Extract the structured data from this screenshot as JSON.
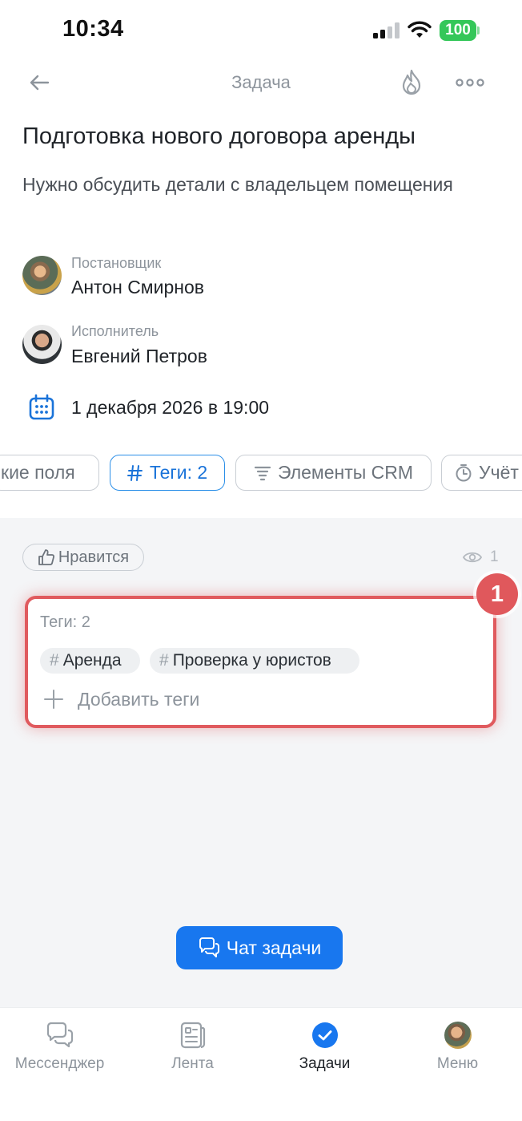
{
  "status_bar": {
    "time": "10:34",
    "battery": "100"
  },
  "header": {
    "title": "Задача"
  },
  "task": {
    "title": "Подготовка нового договора аренды",
    "description": "Нужно обсудить детали с владельцем помещения"
  },
  "creator": {
    "role": "Постановщик",
    "name": "Антон Смирнов"
  },
  "assignee": {
    "role": "Исполнитель",
    "name": "Евгений Петров"
  },
  "deadline": "1 декабря 2026 в 19:00",
  "chips": [
    {
      "label": "кие поля",
      "icon": "fields-icon"
    },
    {
      "label": "Теги: 2",
      "icon": "hash-icon",
      "active": true
    },
    {
      "label": "Элементы CRM",
      "icon": "crm-icon"
    },
    {
      "label": "Учёт",
      "icon": "timer-icon"
    }
  ],
  "like": {
    "label": "Нравится"
  },
  "views": {
    "count": "1"
  },
  "tags_card": {
    "title": "Теги: 2",
    "tags": [
      "Аренда",
      "Проверка у юристов"
    ],
    "hash": "#",
    "add_label": "Добавить теги",
    "badge": "1"
  },
  "chat_button": {
    "label": "Чат задачи"
  },
  "tabbar": {
    "items": [
      {
        "label": "Мессенджер",
        "icon": "messenger-icon"
      },
      {
        "label": "Лента",
        "icon": "feed-icon"
      },
      {
        "label": "Задачи",
        "icon": "tasks-check-icon",
        "active": true
      },
      {
        "label": "Меню",
        "icon": "avatar"
      }
    ]
  },
  "colors": {
    "accent": "#1877ef",
    "highlight": "#e05a5e",
    "battery": "#34c759"
  }
}
